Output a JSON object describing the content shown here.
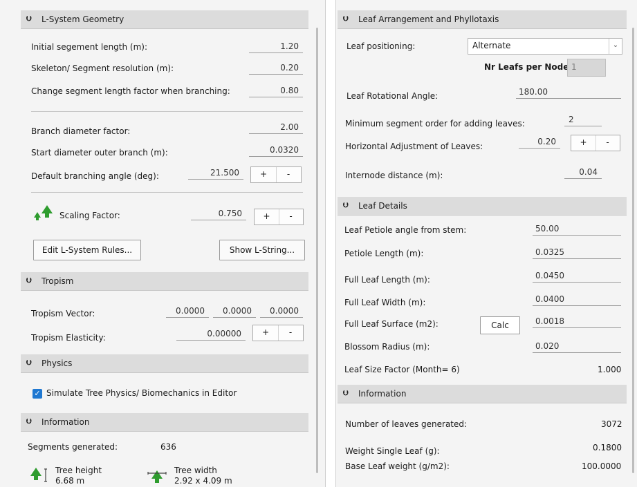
{
  "left": {
    "lsystem": {
      "header": "L-System Geometry",
      "initial_segment_label": "Initial segement length (m):",
      "initial_segment_value": "1.20",
      "skeleton_label": "Skeleton/ Segment  resolution (m):",
      "skeleton_value": "0.20",
      "change_factor_label": "Change segment length factor when branching:",
      "change_factor_value": "0.80",
      "branch_diam_label": "Branch diameter factor:",
      "branch_diam_value": "2.00",
      "start_diam_label": "Start diameter outer branch (m):",
      "start_diam_value": "0.0320",
      "branch_angle_label": "Default branching angle (deg):",
      "branch_angle_value": "21.500",
      "scaling_label": "Scaling Factor:",
      "scaling_value": "0.750",
      "edit_rules_button": "Edit L-System Rules...",
      "show_string_button": "Show L-String..."
    },
    "tropism": {
      "header": "Tropism",
      "vector_label": "Tropism Vector:",
      "vector_x": "0.0000",
      "vector_y": "0.0000",
      "vector_z": "0.0000",
      "elasticity_label": "Tropism Elasticity:",
      "elasticity_value": "0.00000"
    },
    "physics": {
      "header": "Physics",
      "simulate_label": "Simulate Tree Physics/ Biomechanics in Editor",
      "simulate_checked": true
    },
    "information": {
      "header": "Information",
      "segments_label": "Segments generated:",
      "segments_value": "636",
      "height_label": "Tree height",
      "height_value": "6.68 m",
      "width_label": "Tree width",
      "width_value": "2.92 x 4.09 m"
    },
    "plus": "+",
    "minus": "-"
  },
  "right": {
    "arrangement": {
      "header": "Leaf Arrangement and Phyllotaxis",
      "positioning_label": "Leaf positioning:",
      "positioning_value": "Alternate",
      "nr_leafs_label": "Nr Leafs per Node:",
      "nr_leafs_value": "1",
      "rot_angle_label": "Leaf Rotational  Angle:",
      "rot_angle_value": "180.00",
      "min_order_label": "Minimum segment order for adding leaves:",
      "min_order_value": "2",
      "horiz_adj_label": "Horizontal Adjustment of Leaves:",
      "horiz_adj_value": "0.20",
      "internode_label": "Internode distance (m):",
      "internode_value": "0.04"
    },
    "details": {
      "header": "Leaf Details",
      "petiole_angle_label": "Leaf Petiole angle from stem:",
      "petiole_angle_value": "50.00",
      "petiole_length_label": "Petiole Length (m):",
      "petiole_length_value": "0.0325",
      "full_length_label": "Full Leaf Length (m):",
      "full_length_value": "0.0450",
      "full_width_label": "Full Leaf Width (m):",
      "full_width_value": "0.0400",
      "surface_label": "Full Leaf Surface (m2):",
      "calc_button": "Calc",
      "surface_value": "0.0018",
      "blossom_label": "Blossom Radius (m):",
      "blossom_value": "0.020",
      "size_factor_label": "Leaf Size Factor (Month= 6)",
      "size_factor_value": "1.000"
    },
    "information": {
      "header": "Information",
      "leaves_label": "Number of leaves generated:",
      "leaves_value": "3072",
      "weight_label": "Weight Single Leaf (g):",
      "weight_value": "0.1800",
      "base_weight_label": "Base Leaf weight (g/m2):",
      "base_weight_value": "100.0000"
    },
    "plus": "+",
    "minus": "-"
  },
  "icons": {
    "section_chevron": "double-chevron-down-icon",
    "dropdown": "chevron-down-icon",
    "scaling": "tree-scaling-icon",
    "tree_height": "tree-height-icon",
    "tree_width": "tree-width-icon",
    "checkbox": "checkmark-icon"
  },
  "colors": {
    "header_bg": "#dcdcdc",
    "panel_bg": "#f4f4f4",
    "checkbox": "#1f78d1",
    "tree_green": "#2e9c2e"
  }
}
